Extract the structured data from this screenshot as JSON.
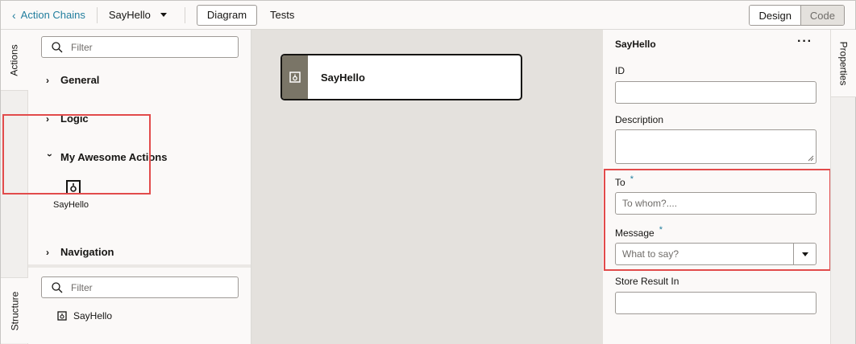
{
  "topbar": {
    "back_label": "Action Chains",
    "chain_name": "SayHello",
    "diagram_label": "Diagram",
    "tests_label": "Tests",
    "design_label": "Design",
    "code_label": "Code"
  },
  "left_tabs": {
    "actions": "Actions",
    "structure": "Structure"
  },
  "actions_panel": {
    "filter_placeholder": "Filter",
    "categories": {
      "general": "General",
      "logic": "Logic",
      "awesome": "My Awesome Actions",
      "navigation": "Navigation"
    },
    "custom_action": "SayHello"
  },
  "structure_panel": {
    "filter_placeholder": "Filter",
    "item": "SayHello"
  },
  "canvas": {
    "node_title": "SayHello"
  },
  "properties": {
    "title": "SayHello",
    "more": "···",
    "id_label": "ID",
    "description_label": "Description",
    "to_label": "To",
    "to_placeholder": "To whom?....",
    "message_label": "Message",
    "message_placeholder": "What to say?",
    "required_mark": "*",
    "store_label": "Store Result In"
  },
  "right_tab": {
    "properties": "Properties"
  },
  "colors": {
    "link": "#227e9e",
    "highlight": "#e24b4b",
    "canvas": "#e4e1dd",
    "node_side": "#7a7567"
  }
}
